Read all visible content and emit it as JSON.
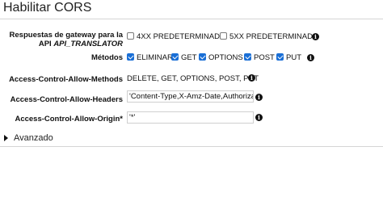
{
  "header": {
    "title": "Habilitar CORS"
  },
  "gateway_responses": {
    "label_line1": "Respuestas de gateway para la",
    "label_prefix": "API ",
    "api_name": "API_TRANSLATOR",
    "options": [
      {
        "label": "4XX PREDETERMINADO",
        "checked": false
      },
      {
        "label": "5XX PREDETERMINADO",
        "checked": false
      }
    ]
  },
  "methods": {
    "label": "Métodos",
    "options": [
      {
        "label": "ELIMINAR",
        "checked": true
      },
      {
        "label": "GET",
        "checked": true
      },
      {
        "label": "OPTIONS",
        "checked": true
      },
      {
        "label": "POST",
        "checked": true
      },
      {
        "label": "PUT",
        "checked": true
      }
    ]
  },
  "allow_methods": {
    "label": "Access-Control-Allow-Methods",
    "value": "DELETE, GET, OPTIONS, POST, PUT"
  },
  "allow_headers": {
    "label": "Access-Control-Allow-Headers",
    "value": "'Content-Type,X-Amz-Date,Authorization,X-Api-Key,X-Amz-Security-Token'"
  },
  "allow_origin": {
    "label": "Access-Control-Allow-Origin*",
    "value": "'*'"
  },
  "advanced": {
    "label": "Avanzado"
  },
  "icons": {
    "info": "info-icon",
    "caret": "caret-right-icon"
  }
}
